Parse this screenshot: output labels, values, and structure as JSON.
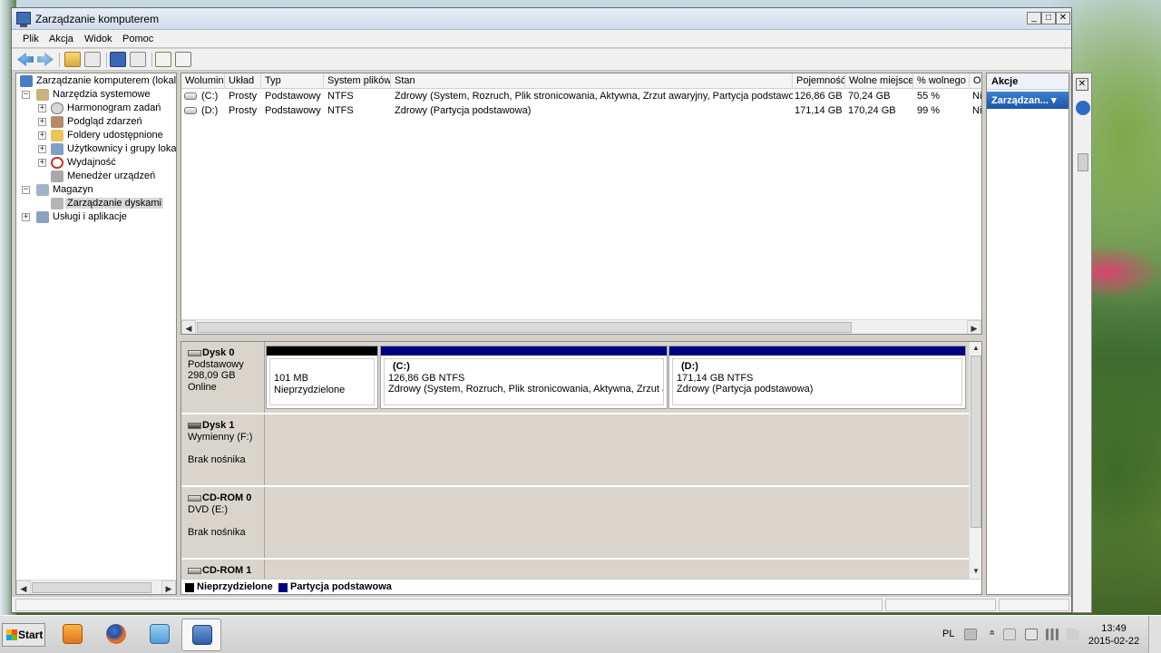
{
  "window": {
    "title": "Zarządzanie komputerem",
    "minimize": "_",
    "maximize": "□",
    "close": "✕"
  },
  "menu": [
    "Plik",
    "Akcja",
    "Widok",
    "Pomoc"
  ],
  "toolbar": {
    "icons": [
      "back-icon",
      "forward-icon",
      "up-icon",
      "console-tree-icon",
      "help-icon",
      "show-hide-icon",
      "refresh-icon",
      "export-icon"
    ]
  },
  "tree": {
    "root": "Zarządzanie komputerem (lokalne)",
    "system_tools": "Narzędzia systemowe",
    "task_scheduler": "Harmonogram zadań",
    "event_viewer": "Podgląd zdarzeń",
    "shared_folders": "Foldery udostępnione",
    "local_users": "Użytkownicy i grupy lokalne",
    "performance": "Wydajność",
    "device_manager": "Menedżer urządzeń",
    "storage": "Magazyn",
    "disk_management": "Zarządzanie dyskami",
    "services": "Usługi i aplikacje",
    "expand_minus": "−",
    "expand_plus": "+"
  },
  "volumes": {
    "columns": [
      "Wolumin",
      "Układ",
      "Typ",
      "System plików",
      "Stan",
      "Pojemność",
      "Wolne miejsce",
      "% wolnego",
      "O"
    ],
    "rows": [
      [
        "(C:)",
        "Prosty",
        "Podstawowy",
        "NTFS",
        "Zdrowy (System, Rozruch, Plik stronicowania, Aktywna, Zrzut awaryjny, Partycja podstawowa)",
        "126,86 GB",
        "70,24 GB",
        "55 %",
        "Ni"
      ],
      [
        "(D:)",
        "Prosty",
        "Podstawowy",
        "NTFS",
        "Zdrowy (Partycja podstawowa)",
        "171,14 GB",
        "170,24 GB",
        "99 %",
        "Ni"
      ]
    ]
  },
  "disks": {
    "disk0": {
      "name": "Dysk 0",
      "type": "Podstawowy",
      "size": "298,09 GB",
      "status": "Online",
      "unallocated": {
        "size": "101 MB",
        "label": "Nieprzydzielone"
      },
      "part_c": {
        "letter": "(C:)",
        "size": "126,86 GB NTFS",
        "status": "Zdrowy (System, Rozruch, Plik stronicowania, Aktywna, Zrzut awar"
      },
      "part_d": {
        "letter": "(D:)",
        "size": "171,14 GB NTFS",
        "status": "Zdrowy (Partycja podstawowa)"
      }
    },
    "disk1": {
      "name": "Dysk 1",
      "type": "Wymienny (F:)",
      "media": "Brak nośnika"
    },
    "cdrom0": {
      "name": "CD-ROM 0",
      "type": "DVD (E:)",
      "media": "Brak nośnika"
    },
    "cdrom1": {
      "name": "CD-ROM 1"
    }
  },
  "legend": {
    "unallocated": "Nieprzydzielone",
    "primary": "Partycja podstawowa",
    "unallocated_color": "#000000",
    "primary_color": "#000080"
  },
  "actions": {
    "title": "Akcje",
    "section": "Zarządzan... ▾"
  },
  "taskbar": {
    "start": "Start",
    "language": "PL",
    "time": "13:49",
    "date": "2015-02-22",
    "chevron": "«"
  },
  "scroll": {
    "left": "◀",
    "right": "▶",
    "up": "▲",
    "down": "▼"
  }
}
